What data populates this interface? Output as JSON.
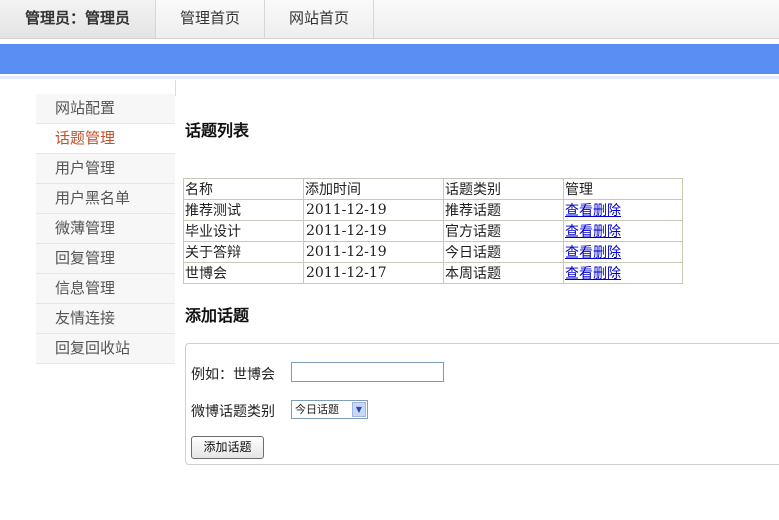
{
  "nav": {
    "admin_label": "管理员：管理员",
    "home_label": "管理首页",
    "site_label": "网站首页"
  },
  "sidebar": {
    "items": [
      {
        "label": "网站配置"
      },
      {
        "label": "话题管理",
        "active": true
      },
      {
        "label": "用户管理"
      },
      {
        "label": "用户黑名单"
      },
      {
        "label": "微薄管理"
      },
      {
        "label": "回复管理"
      },
      {
        "label": "信息管理"
      },
      {
        "label": "友情连接"
      },
      {
        "label": "回复回收站"
      }
    ]
  },
  "main": {
    "list_title": "话题列表",
    "table": {
      "headers": [
        "名称",
        "添加时间",
        "话题类别",
        "管理"
      ],
      "rows": [
        {
          "name": "推荐测试",
          "date": "2011-12-19",
          "category": "推荐话题",
          "view": "查看",
          "delete": "删除"
        },
        {
          "name": "毕业设计",
          "date": "2011-12-19",
          "category": "官方话题",
          "view": "查看",
          "delete": "删除"
        },
        {
          "name": "关于答辩",
          "date": "2011-12-19",
          "category": "今日话题",
          "view": "查看",
          "delete": "删除"
        },
        {
          "name": "世博会",
          "date": "2011-12-17",
          "category": "本周话题",
          "view": "查看",
          "delete": "删除"
        }
      ]
    },
    "add_title": "添加话题",
    "form": {
      "example_label": "例如：世博会",
      "topic_input_value": "",
      "category_label": "微博话题类别",
      "category_selected": "今日话题",
      "submit_label": "添加话题"
    }
  },
  "colors": {
    "accent_bar": "#5b8ef2",
    "active_sidebar": "#c2512b",
    "link": "#0000cc"
  }
}
